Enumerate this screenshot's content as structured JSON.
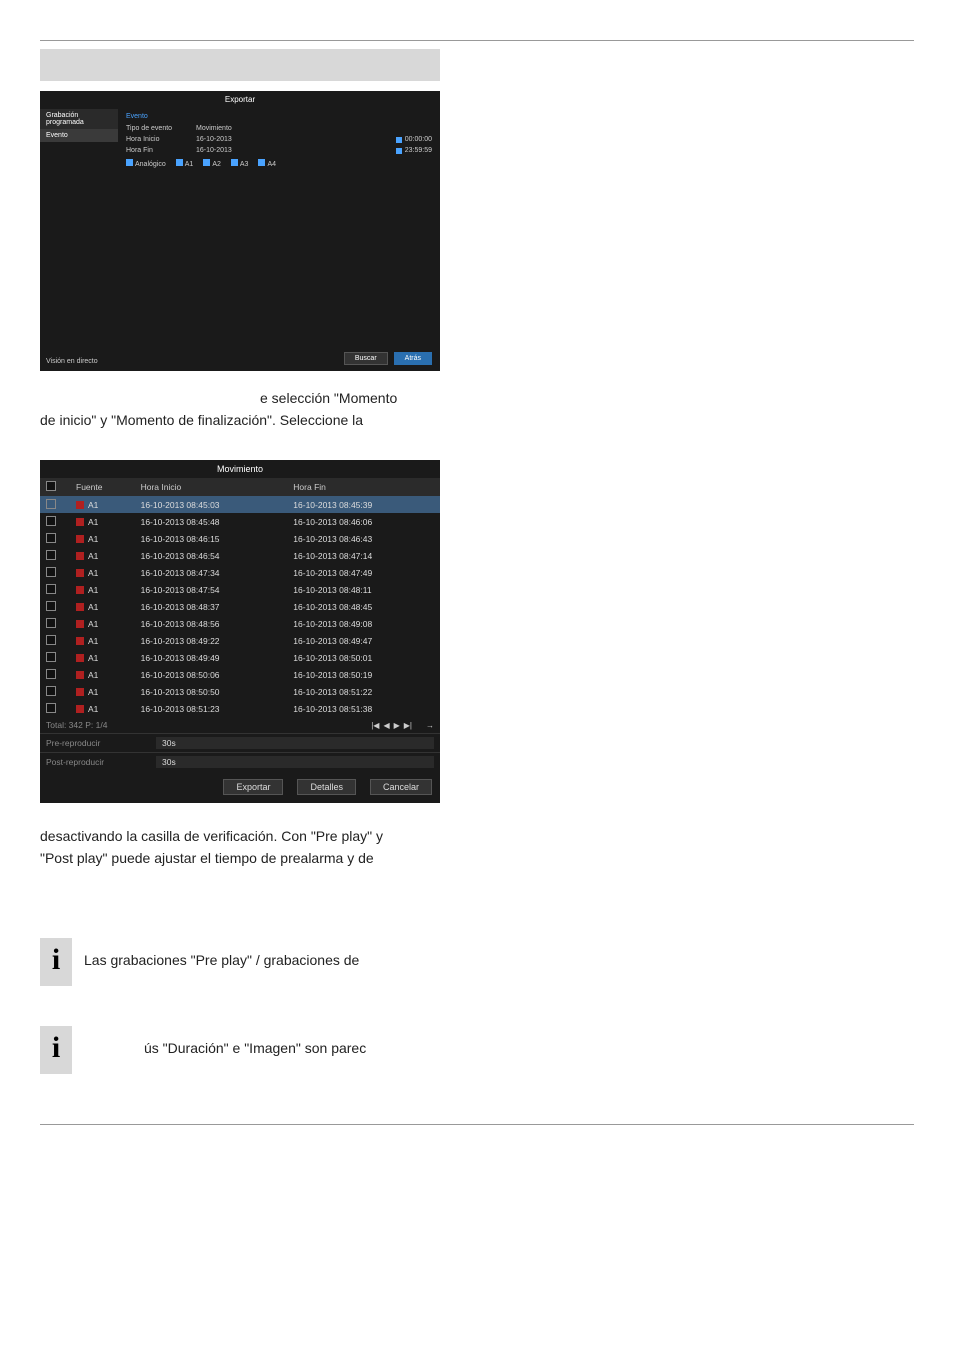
{
  "panel1": {
    "title": "Exportar",
    "side_head": "Grabación programada",
    "side_item": "Evento",
    "side_bottom": "Visión en directo",
    "main_head": "Evento",
    "rows": [
      {
        "lab": "Tipo de evento",
        "val": "Movimiento"
      },
      {
        "lab": "Hora Inicio",
        "val": "16-10-2013",
        "time": "00:00:00"
      },
      {
        "lab": "Hora Fin",
        "val": "16-10-2013",
        "time": "23:59:59"
      }
    ],
    "analog_label": "Analógico",
    "analog": [
      "A1",
      "A2",
      "A3",
      "A4"
    ],
    "btn_search": "Buscar",
    "btn_back": "Atrás"
  },
  "text_after_panel1_a": "e selección \"Momento",
  "text_after_panel1_b": "de inicio\" y \"Momento de finalización\". Seleccione la",
  "panel2": {
    "title": "Movimiento",
    "col_fuente": "Fuente",
    "col_inicio": "Hora Inicio",
    "col_fin": "Hora Fin",
    "rows": [
      {
        "src": "A1",
        "ini": "16-10-2013 08:45:03",
        "fin": "16-10-2013 08:45:39",
        "hl": true
      },
      {
        "src": "A1",
        "ini": "16-10-2013 08:45:48",
        "fin": "16-10-2013 08:46:06"
      },
      {
        "src": "A1",
        "ini": "16-10-2013 08:46:15",
        "fin": "16-10-2013 08:46:43"
      },
      {
        "src": "A1",
        "ini": "16-10-2013 08:46:54",
        "fin": "16-10-2013 08:47:14"
      },
      {
        "src": "A1",
        "ini": "16-10-2013 08:47:34",
        "fin": "16-10-2013 08:47:49"
      },
      {
        "src": "A1",
        "ini": "16-10-2013 08:47:54",
        "fin": "16-10-2013 08:48:11"
      },
      {
        "src": "A1",
        "ini": "16-10-2013 08:48:37",
        "fin": "16-10-2013 08:48:45"
      },
      {
        "src": "A1",
        "ini": "16-10-2013 08:48:56",
        "fin": "16-10-2013 08:49:08"
      },
      {
        "src": "A1",
        "ini": "16-10-2013 08:49:22",
        "fin": "16-10-2013 08:49:47"
      },
      {
        "src": "A1",
        "ini": "16-10-2013 08:49:49",
        "fin": "16-10-2013 08:50:01"
      },
      {
        "src": "A1",
        "ini": "16-10-2013 08:50:06",
        "fin": "16-10-2013 08:50:19"
      },
      {
        "src": "A1",
        "ini": "16-10-2013 08:50:50",
        "fin": "16-10-2013 08:51:22"
      },
      {
        "src": "A1",
        "ini": "16-10-2013 08:51:23",
        "fin": "16-10-2013 08:51:38"
      }
    ],
    "total": "Total: 342 P: 1/4",
    "pre_label": "Pre-reproducir",
    "pre_val": "30s",
    "post_label": "Post-reproducir",
    "post_val": "30s",
    "btn_export": "Exportar",
    "btn_details": "Detalles",
    "btn_cancel": "Cancelar"
  },
  "text_after_panel2_a": "desactivando la casilla de verificación. Con \"Pre play\" y",
  "text_after_panel2_b": "\"Post play\" puede ajustar el tiempo de prealarma y de",
  "info1": "Las grabaciones \"Pre play\" / grabaciones de",
  "info2": "ús \"Duración\" e \"Imagen\" son parec",
  "pager": {
    "first": "|◀",
    "prev": "◀",
    "next": "▶",
    "last": "▶|",
    "arrow": "→"
  }
}
